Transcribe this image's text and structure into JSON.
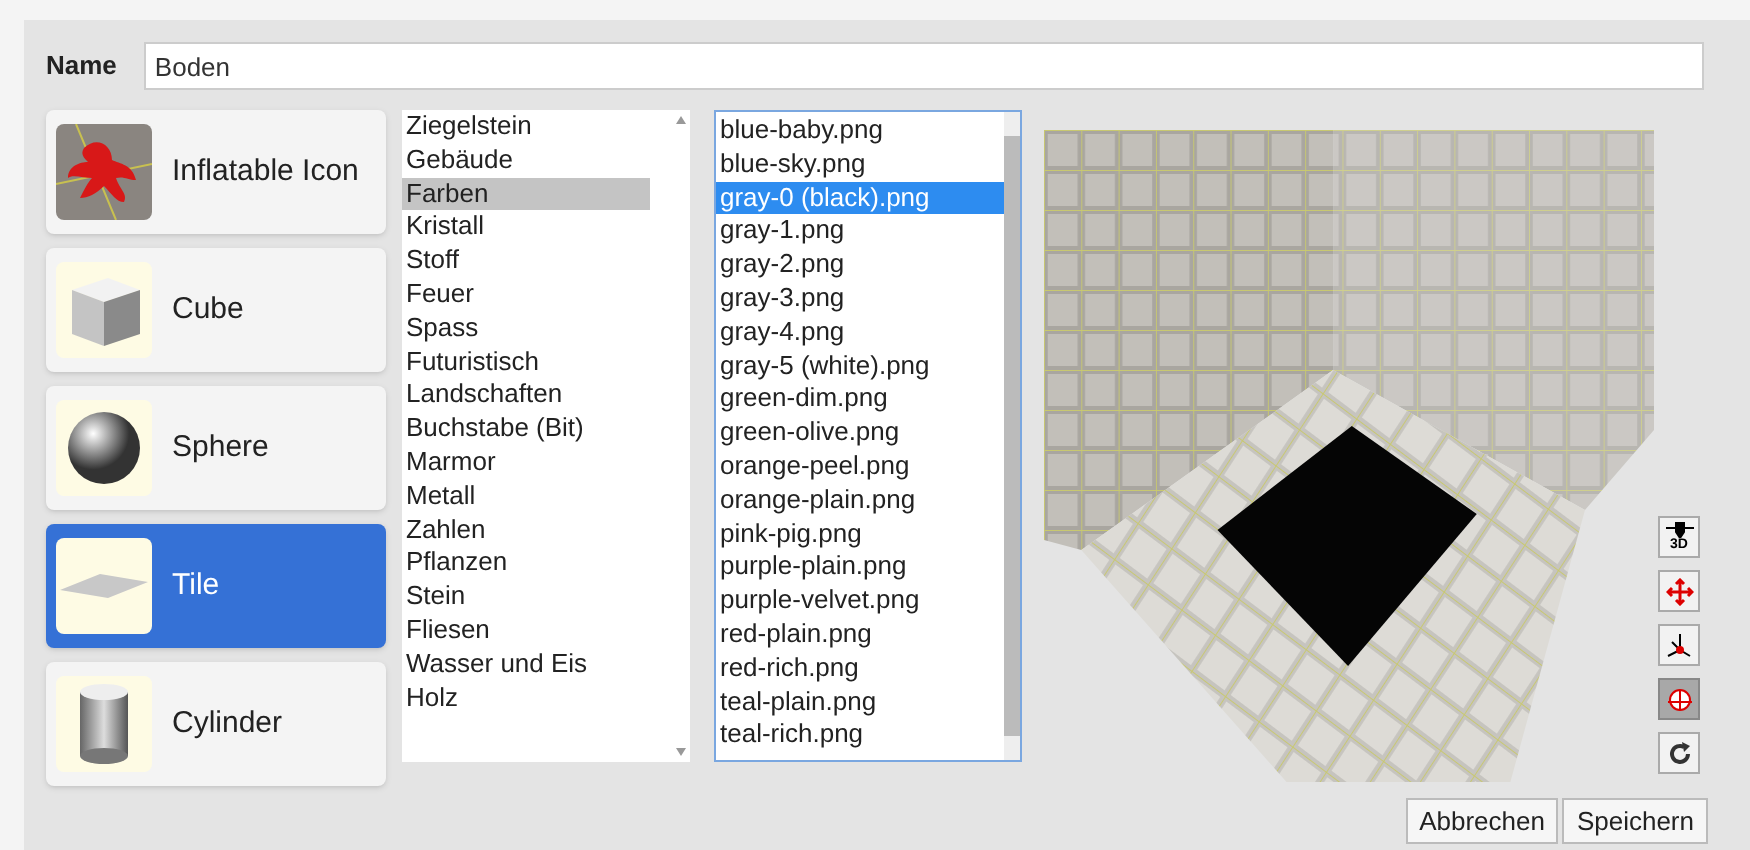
{
  "name_field": {
    "label": "Name",
    "value": "Boden"
  },
  "shapes": [
    {
      "label": "Inflatable Icon",
      "kind": "inflatable",
      "selected": false
    },
    {
      "label": "Cube",
      "kind": "cube",
      "selected": false
    },
    {
      "label": "Sphere",
      "kind": "sphere",
      "selected": false
    },
    {
      "label": "Tile",
      "kind": "tile",
      "selected": true
    },
    {
      "label": "Cylinder",
      "kind": "cylinder",
      "selected": false
    }
  ],
  "categories": [
    {
      "label": "Ziegelstein",
      "selected": false
    },
    {
      "label": "Gebäude",
      "selected": false
    },
    {
      "label": "Farben",
      "selected": true
    },
    {
      "label": "Kristall",
      "selected": false
    },
    {
      "label": "Stoff",
      "selected": false
    },
    {
      "label": "Feuer",
      "selected": false
    },
    {
      "label": "Spass",
      "selected": false
    },
    {
      "label": "Futuristisch",
      "selected": false
    },
    {
      "label": "Landschaften",
      "selected": false
    },
    {
      "label": "Buchstabe (Bit)",
      "selected": false
    },
    {
      "label": "Marmor",
      "selected": false
    },
    {
      "label": "Metall",
      "selected": false
    },
    {
      "label": "Zahlen",
      "selected": false
    },
    {
      "label": "Pflanzen",
      "selected": false
    },
    {
      "label": "Stein",
      "selected": false
    },
    {
      "label": "Fliesen",
      "selected": false
    },
    {
      "label": "Wasser und Eis",
      "selected": false
    },
    {
      "label": "Holz",
      "selected": false
    }
  ],
  "textures": [
    {
      "label": "blue-baby.png",
      "selected": false
    },
    {
      "label": "blue-sky.png",
      "selected": false
    },
    {
      "label": "gray-0 (black).png",
      "selected": true
    },
    {
      "label": "gray-1.png",
      "selected": false
    },
    {
      "label": "gray-2.png",
      "selected": false
    },
    {
      "label": "gray-3.png",
      "selected": false
    },
    {
      "label": "gray-4.png",
      "selected": false
    },
    {
      "label": "gray-5 (white).png",
      "selected": false
    },
    {
      "label": "green-dim.png",
      "selected": false
    },
    {
      "label": "green-olive.png",
      "selected": false
    },
    {
      "label": "orange-peel.png",
      "selected": false
    },
    {
      "label": "orange-plain.png",
      "selected": false
    },
    {
      "label": "pink-pig.png",
      "selected": false
    },
    {
      "label": "purple-plain.png",
      "selected": false
    },
    {
      "label": "purple-velvet.png",
      "selected": false
    },
    {
      "label": "red-plain.png",
      "selected": false
    },
    {
      "label": "red-rich.png",
      "selected": false
    },
    {
      "label": "teal-plain.png",
      "selected": false
    },
    {
      "label": "teal-rich.png",
      "selected": false
    }
  ],
  "view_tools": [
    {
      "kind": "view3d",
      "label": "3D",
      "selected": false
    },
    {
      "kind": "move",
      "selected": false
    },
    {
      "kind": "axes",
      "selected": false
    },
    {
      "kind": "rotate",
      "selected": true
    },
    {
      "kind": "reset",
      "selected": false
    }
  ],
  "buttons": [
    "Abbrechen",
    "Speichern"
  ]
}
